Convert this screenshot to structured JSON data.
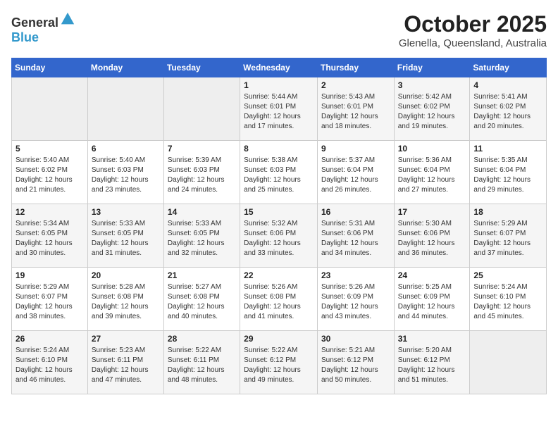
{
  "header": {
    "logo_general": "General",
    "logo_blue": "Blue",
    "title": "October 2025",
    "subtitle": "Glenella, Queensland, Australia"
  },
  "days_of_week": [
    "Sunday",
    "Monday",
    "Tuesday",
    "Wednesday",
    "Thursday",
    "Friday",
    "Saturday"
  ],
  "weeks": [
    [
      {
        "date": "",
        "info": ""
      },
      {
        "date": "",
        "info": ""
      },
      {
        "date": "",
        "info": ""
      },
      {
        "date": "1",
        "info": "Sunrise: 5:44 AM\nSunset: 6:01 PM\nDaylight: 12 hours\nand 17 minutes."
      },
      {
        "date": "2",
        "info": "Sunrise: 5:43 AM\nSunset: 6:01 PM\nDaylight: 12 hours\nand 18 minutes."
      },
      {
        "date": "3",
        "info": "Sunrise: 5:42 AM\nSunset: 6:02 PM\nDaylight: 12 hours\nand 19 minutes."
      },
      {
        "date": "4",
        "info": "Sunrise: 5:41 AM\nSunset: 6:02 PM\nDaylight: 12 hours\nand 20 minutes."
      }
    ],
    [
      {
        "date": "5",
        "info": "Sunrise: 5:40 AM\nSunset: 6:02 PM\nDaylight: 12 hours\nand 21 minutes."
      },
      {
        "date": "6",
        "info": "Sunrise: 5:40 AM\nSunset: 6:03 PM\nDaylight: 12 hours\nand 23 minutes."
      },
      {
        "date": "7",
        "info": "Sunrise: 5:39 AM\nSunset: 6:03 PM\nDaylight: 12 hours\nand 24 minutes."
      },
      {
        "date": "8",
        "info": "Sunrise: 5:38 AM\nSunset: 6:03 PM\nDaylight: 12 hours\nand 25 minutes."
      },
      {
        "date": "9",
        "info": "Sunrise: 5:37 AM\nSunset: 6:04 PM\nDaylight: 12 hours\nand 26 minutes."
      },
      {
        "date": "10",
        "info": "Sunrise: 5:36 AM\nSunset: 6:04 PM\nDaylight: 12 hours\nand 27 minutes."
      },
      {
        "date": "11",
        "info": "Sunrise: 5:35 AM\nSunset: 6:04 PM\nDaylight: 12 hours\nand 29 minutes."
      }
    ],
    [
      {
        "date": "12",
        "info": "Sunrise: 5:34 AM\nSunset: 6:05 PM\nDaylight: 12 hours\nand 30 minutes."
      },
      {
        "date": "13",
        "info": "Sunrise: 5:33 AM\nSunset: 6:05 PM\nDaylight: 12 hours\nand 31 minutes."
      },
      {
        "date": "14",
        "info": "Sunrise: 5:33 AM\nSunset: 6:05 PM\nDaylight: 12 hours\nand 32 minutes."
      },
      {
        "date": "15",
        "info": "Sunrise: 5:32 AM\nSunset: 6:06 PM\nDaylight: 12 hours\nand 33 minutes."
      },
      {
        "date": "16",
        "info": "Sunrise: 5:31 AM\nSunset: 6:06 PM\nDaylight: 12 hours\nand 34 minutes."
      },
      {
        "date": "17",
        "info": "Sunrise: 5:30 AM\nSunset: 6:06 PM\nDaylight: 12 hours\nand 36 minutes."
      },
      {
        "date": "18",
        "info": "Sunrise: 5:29 AM\nSunset: 6:07 PM\nDaylight: 12 hours\nand 37 minutes."
      }
    ],
    [
      {
        "date": "19",
        "info": "Sunrise: 5:29 AM\nSunset: 6:07 PM\nDaylight: 12 hours\nand 38 minutes."
      },
      {
        "date": "20",
        "info": "Sunrise: 5:28 AM\nSunset: 6:08 PM\nDaylight: 12 hours\nand 39 minutes."
      },
      {
        "date": "21",
        "info": "Sunrise: 5:27 AM\nSunset: 6:08 PM\nDaylight: 12 hours\nand 40 minutes."
      },
      {
        "date": "22",
        "info": "Sunrise: 5:26 AM\nSunset: 6:08 PM\nDaylight: 12 hours\nand 41 minutes."
      },
      {
        "date": "23",
        "info": "Sunrise: 5:26 AM\nSunset: 6:09 PM\nDaylight: 12 hours\nand 43 minutes."
      },
      {
        "date": "24",
        "info": "Sunrise: 5:25 AM\nSunset: 6:09 PM\nDaylight: 12 hours\nand 44 minutes."
      },
      {
        "date": "25",
        "info": "Sunrise: 5:24 AM\nSunset: 6:10 PM\nDaylight: 12 hours\nand 45 minutes."
      }
    ],
    [
      {
        "date": "26",
        "info": "Sunrise: 5:24 AM\nSunset: 6:10 PM\nDaylight: 12 hours\nand 46 minutes."
      },
      {
        "date": "27",
        "info": "Sunrise: 5:23 AM\nSunset: 6:11 PM\nDaylight: 12 hours\nand 47 minutes."
      },
      {
        "date": "28",
        "info": "Sunrise: 5:22 AM\nSunset: 6:11 PM\nDaylight: 12 hours\nand 48 minutes."
      },
      {
        "date": "29",
        "info": "Sunrise: 5:22 AM\nSunset: 6:12 PM\nDaylight: 12 hours\nand 49 minutes."
      },
      {
        "date": "30",
        "info": "Sunrise: 5:21 AM\nSunset: 6:12 PM\nDaylight: 12 hours\nand 50 minutes."
      },
      {
        "date": "31",
        "info": "Sunrise: 5:20 AM\nSunset: 6:12 PM\nDaylight: 12 hours\nand 51 minutes."
      },
      {
        "date": "",
        "info": ""
      }
    ]
  ]
}
